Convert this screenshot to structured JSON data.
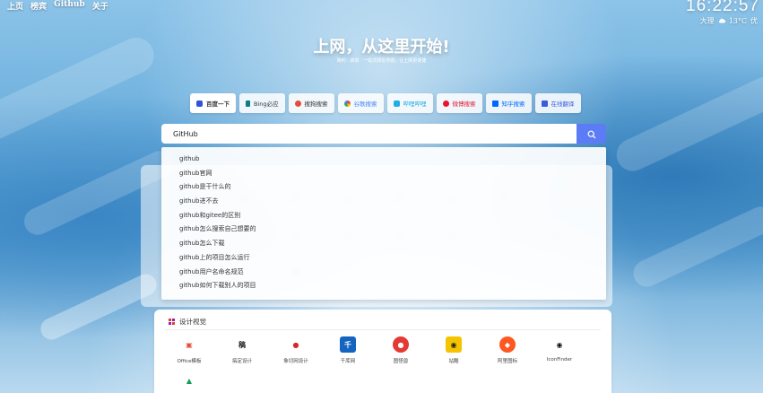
{
  "topnav": {
    "items": [
      "上页",
      "榜宾",
      "Github",
      "关于"
    ]
  },
  "clock": {
    "time": "16:22:57"
  },
  "weather": {
    "city": "大理",
    "icon": "cloud-icon",
    "temp": "13°C",
    "cond": "优"
  },
  "hero": {
    "title": "上网，从这里开始!",
    "subtitle": "简约 · 高效 · 一站式网址导航，让上网更便捷"
  },
  "engines": [
    {
      "label": "百度一下",
      "color": "#2f55d4",
      "active": true
    },
    {
      "label": "Bing必应",
      "color": "#0e7a8a"
    },
    {
      "label": "搜狗搜索",
      "color": "#e84b3c"
    },
    {
      "label": "谷歌搜索",
      "color": "#4285f4"
    },
    {
      "label": "哔哩哔哩",
      "color": "#23ade5"
    },
    {
      "label": "微博搜索",
      "color": "#e6162d"
    },
    {
      "label": "知乎搜索",
      "color": "#0066ff"
    },
    {
      "label": "在线翻译",
      "color": "#3b5bdb"
    }
  ],
  "search": {
    "value": "GitHub"
  },
  "suggestions": [
    "github",
    "github官网",
    "github是干什么的",
    "github进不去",
    "github和gitee的区别",
    "github怎么搜索自己想要的",
    "github怎么下载",
    "github上的项目怎么运行",
    "github用户名命名规范",
    "github如何下载别人的项目"
  ],
  "design": {
    "title": "设计视觉",
    "sites": [
      {
        "label": "Office模板",
        "logo": "▣",
        "color": "#e74c3c"
      },
      {
        "label": "搞定设计",
        "logo": "稿",
        "color": "#222222"
      },
      {
        "label": "象切网设计",
        "logo": "●",
        "color": "#d62828"
      },
      {
        "label": "千库网",
        "logo": "千",
        "color": "#1565c0"
      },
      {
        "label": "图怪兽",
        "logo": "●",
        "color": "#e53935"
      },
      {
        "label": "站酷",
        "logo": "◉",
        "color": "#f5c400"
      },
      {
        "label": "阿里图标",
        "logo": "◆",
        "color": "#ff5722"
      },
      {
        "label": "IconFinder",
        "logo": "◉",
        "color": "#111111"
      },
      {
        "label": "",
        "logo": "▲",
        "color": "#0f9d58"
      }
    ]
  }
}
